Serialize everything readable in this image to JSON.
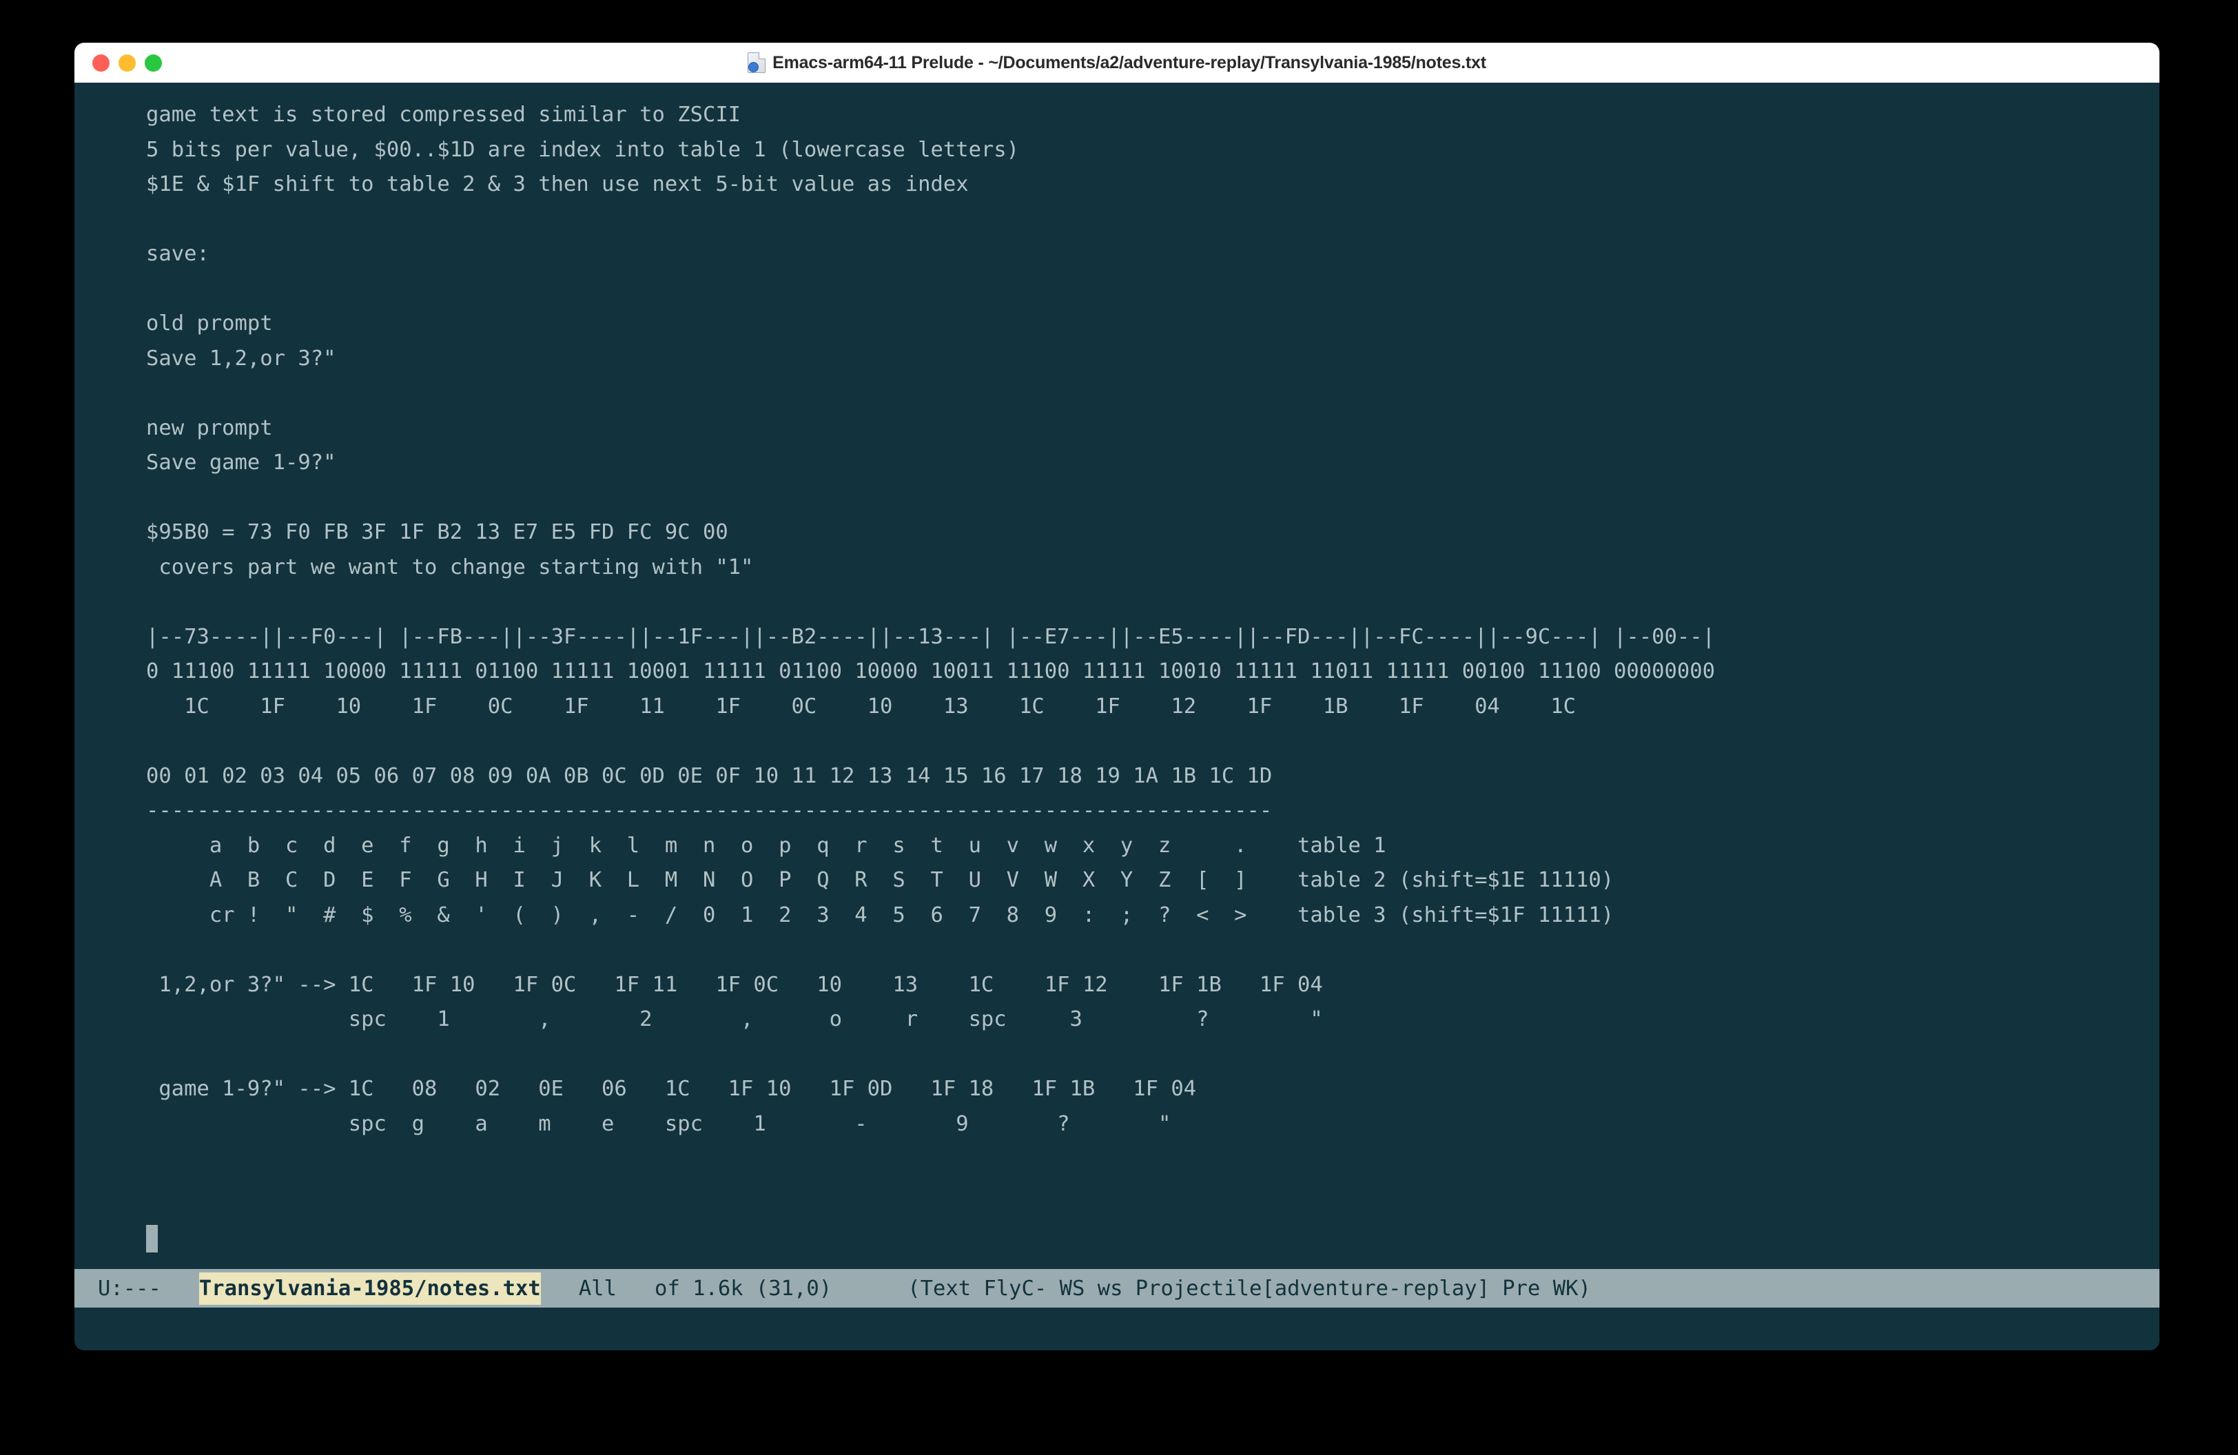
{
  "window": {
    "title": "Emacs-arm64-11 Prelude - ~/Documents/a2/adventure-replay/Transylvania-1985/notes.txt",
    "title_icon": "document-globe-icon",
    "traffic_lights": {
      "close": "close-button",
      "minimize": "minimize-button",
      "maximize": "maximize-button"
    },
    "colors": {
      "background": "#12323d",
      "foreground": "#b2c2c6",
      "titlebar": "#ffffff",
      "modeline_bg": "#9aacb0",
      "modeline_fg": "#12323d",
      "buffer_name_highlight": "#ede5bb",
      "cursor": "#9fb0b5",
      "close_dot": "#ff5f57",
      "minimize_dot": "#febc2e",
      "maximize_dot": "#28c840"
    }
  },
  "buffer": {
    "text": "game text is stored compressed similar to ZSCII\n5 bits per value, $00..$1D are index into table 1 (lowercase letters)\n$1E & $1F shift to table 2 & 3 then use next 5-bit value as index\n\nsave:\n\nold prompt\nSave 1,2,or 3?\"\n\nnew prompt\nSave game 1-9?\"\n\n$95B0 = 73 F0 FB 3F 1F B2 13 E7 E5 FD FC 9C 00\n covers part we want to change starting with \"1\"\n\n|--73----||--F0---| |--FB---||--3F----||--1F---||--B2----||--13---| |--E7---||--E5----||--FD---||--FC----||--9C---| |--00--|\n0 11100 11111 10000 11111 01100 11111 10001 11111 01100 10000 10011 11100 11111 10010 11111 11011 11111 00100 11100 00000000\n   1C    1F    10    1F    0C    1F    11    1F    0C    10    13    1C    1F    12    1F    1B    1F    04    1C\n\n00 01 02 03 04 05 06 07 08 09 0A 0B 0C 0D 0E 0F 10 11 12 13 14 15 16 17 18 19 1A 1B 1C 1D\n-----------------------------------------------------------------------------------------\n     a  b  c  d  e  f  g  h  i  j  k  l  m  n  o  p  q  r  s  t  u  v  w  x  y  z     .    table 1\n     A  B  C  D  E  F  G  H  I  J  K  L  M  N  O  P  Q  R  S  T  U  V  W  X  Y  Z  [  ]    table 2 (shift=$1E 11110)\n     cr !  \"  #  $  %  &  '  (  )  ,  -  /  0  1  2  3  4  5  6  7  8  9  :  ;  ?  <  >    table 3 (shift=$1F 11111)\n\n 1,2,or 3?\" --> 1C   1F 10   1F 0C   1F 11   1F 0C   10    13    1C    1F 12    1F 1B   1F 04\n                spc    1       ,       2       ,      o     r    spc     3         ?        \"\n\n game 1-9?\" --> 1C   08   02   0E   06   1C   1F 10   1F 0D   1F 18   1F 1B   1F 04\n                spc  g    a    m    e    spc    1       -       9       ?       \""
  },
  "modeline": {
    "status": "U:---",
    "buffer_name": "Transylvania-1985/notes.txt",
    "position": "All",
    "size_info": "of 1.6k (31,0)",
    "modes": "(Text FlyC- WS ws Projectile[adventure-replay] Pre WK)"
  }
}
